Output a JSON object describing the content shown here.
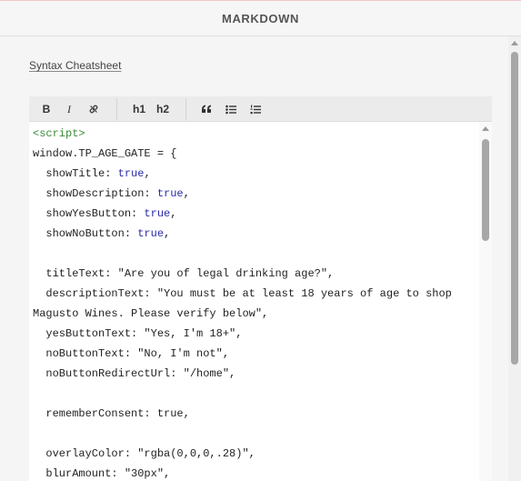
{
  "header": {
    "title": "MARKDOWN"
  },
  "links": {
    "cheatsheet": "Syntax Cheatsheet"
  },
  "toolbar": {
    "bold": "B",
    "italic": "I",
    "h1": "h1",
    "h2": "h2"
  },
  "icons": {
    "bold": "bold-icon",
    "italic": "italic-icon",
    "link": "link-icon",
    "quote": "quote-icon",
    "bullet_list": "bullet-list-icon",
    "numbered_list": "numbered-list-icon"
  },
  "code": {
    "l1": "<script>",
    "l2": "window.TP_AGE_GATE = {",
    "l3_key": "  showTitle: ",
    "l3_val": "true",
    "l3_end": ",",
    "l4_key": "  showDescription: ",
    "l4_val": "true",
    "l4_end": ",",
    "l5_key": "  showYesButton: ",
    "l5_val": "true",
    "l5_end": ",",
    "l6_key": "  showNoButton: ",
    "l6_val": "true",
    "l6_end": ",",
    "l7": "",
    "l8": "  titleText: \"Are you of legal drinking age?\",",
    "l9": "  descriptionText: \"You must be at least 18 years of age to shop",
    "l10": "Magusto Wines. Please verify below\",",
    "l11": "  yesButtonText: \"Yes, I'm 18+\",",
    "l12": "  noButtonText: \"No, I'm not\",",
    "l13": "  noButtonRedirectUrl: \"/home\",",
    "l14": "",
    "l15": "  rememberConsent: true,",
    "l16": "",
    "l17": "  overlayColor: \"rgba(0,0,0,.28)\",",
    "l18": "  blurAmount: \"30px\","
  },
  "colors": {
    "tag": "#3a8c3a",
    "keyword": "#2a2aa8",
    "accent": "#f0c8cc"
  }
}
